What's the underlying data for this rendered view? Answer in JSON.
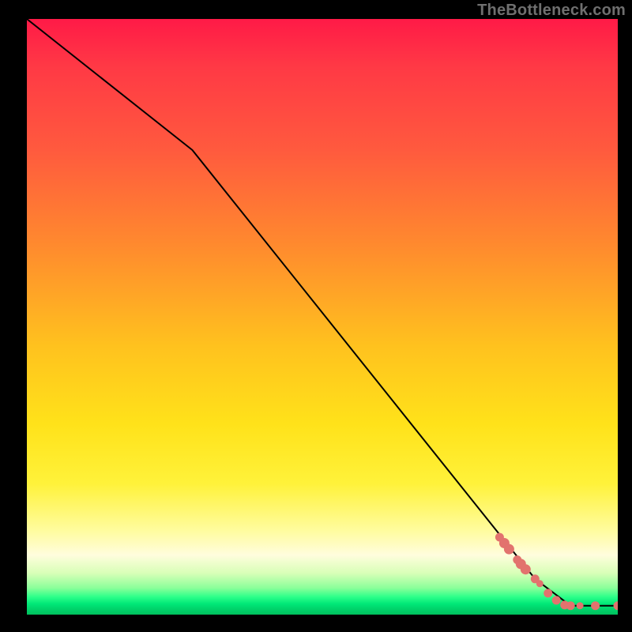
{
  "meta": {
    "watermark": "TheBottleneck.com"
  },
  "chart_data": {
    "type": "line",
    "title": "",
    "xlabel": "",
    "ylabel": "",
    "xlim": [
      0,
      100
    ],
    "ylim": [
      0,
      100
    ],
    "grid": false,
    "axes_visible": false,
    "legend": null,
    "gradient": {
      "top_color": "#ff1a47",
      "mid_color": "#ffe21a",
      "bottom_color": "#00c05e"
    },
    "series": [
      {
        "name": "curve",
        "style": "line",
        "color": "#000000",
        "points": [
          {
            "x": 0,
            "y": 100
          },
          {
            "x": 28,
            "y": 78
          },
          {
            "x": 86,
            "y": 6
          },
          {
            "x": 92,
            "y": 1.5
          },
          {
            "x": 100,
            "y": 1.5
          }
        ]
      },
      {
        "name": "markers",
        "style": "scatter",
        "color": "#e2736e",
        "points": [
          {
            "x": 80.0,
            "y": 13.0,
            "size": 5
          },
          {
            "x": 80.8,
            "y": 12.0,
            "size": 6
          },
          {
            "x": 81.6,
            "y": 11.0,
            "size": 6
          },
          {
            "x": 83.0,
            "y": 9.2,
            "size": 5
          },
          {
            "x": 83.6,
            "y": 8.5,
            "size": 6
          },
          {
            "x": 84.4,
            "y": 7.6,
            "size": 6
          },
          {
            "x": 86.0,
            "y": 6.0,
            "size": 5
          },
          {
            "x": 86.8,
            "y": 5.2,
            "size": 4
          },
          {
            "x": 88.2,
            "y": 3.6,
            "size": 5
          },
          {
            "x": 89.6,
            "y": 2.4,
            "size": 5
          },
          {
            "x": 91.0,
            "y": 1.6,
            "size": 5
          },
          {
            "x": 92.0,
            "y": 1.5,
            "size": 5
          },
          {
            "x": 93.6,
            "y": 1.5,
            "size": 4
          },
          {
            "x": 96.2,
            "y": 1.5,
            "size": 5
          },
          {
            "x": 100.0,
            "y": 1.5,
            "size": 5
          }
        ]
      }
    ]
  }
}
